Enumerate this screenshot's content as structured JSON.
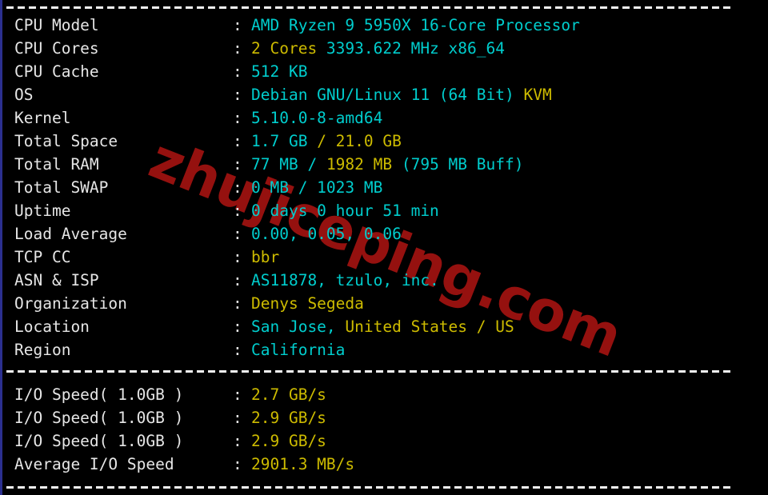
{
  "terminal": {
    "watermark": "zhujiceping.com",
    "colon": ":",
    "colors": {
      "background": "#000000",
      "label": "#e6e6e6",
      "cyan": "#00cdcd",
      "yellow": "#cdbb00",
      "watermark": "#9c1210",
      "gutter": "#2b2f8f",
      "rule": "#f2f2f2"
    }
  },
  "system_info": [
    {
      "label": "CPU Model",
      "segments": [
        {
          "text": "AMD Ryzen 9 5950X 16-Core Processor",
          "color": "cyan"
        }
      ]
    },
    {
      "label": "CPU Cores",
      "segments": [
        {
          "text": "2 Cores ",
          "color": "yellow"
        },
        {
          "text": "3393.622 MHz x86_64",
          "color": "cyan"
        }
      ]
    },
    {
      "label": "CPU Cache",
      "segments": [
        {
          "text": "512 KB",
          "color": "cyan"
        }
      ]
    },
    {
      "label": "OS",
      "segments": [
        {
          "text": "Debian GNU/Linux 11 (64 Bit) ",
          "color": "cyan"
        },
        {
          "text": "KVM",
          "color": "yellow"
        }
      ]
    },
    {
      "label": "Kernel",
      "segments": [
        {
          "text": "5.10.0-8-amd64",
          "color": "cyan"
        }
      ]
    },
    {
      "label": "Total Space",
      "segments": [
        {
          "text": "1.7 GB ",
          "color": "cyan"
        },
        {
          "text": "/ ",
          "color": "yellow"
        },
        {
          "text": "21.0 GB",
          "color": "yellow"
        }
      ]
    },
    {
      "label": "Total RAM",
      "segments": [
        {
          "text": "77 MB ",
          "color": "cyan"
        },
        {
          "text": "/ ",
          "color": "cyan"
        },
        {
          "text": "1982 MB ",
          "color": "yellow"
        },
        {
          "text": "(795 MB Buff)",
          "color": "cyan"
        }
      ]
    },
    {
      "label": "Total SWAP",
      "segments": [
        {
          "text": "0 MB / 1023 MB",
          "color": "cyan"
        }
      ]
    },
    {
      "label": "Uptime",
      "segments": [
        {
          "text": "0 days 0 hour 51 min",
          "color": "cyan"
        }
      ]
    },
    {
      "label": "Load Average",
      "segments": [
        {
          "text": "0.00, 0.05, 0.06",
          "color": "cyan"
        }
      ]
    },
    {
      "label": "TCP CC",
      "segments": [
        {
          "text": "bbr",
          "color": "yellow"
        }
      ]
    },
    {
      "label": "ASN & ISP",
      "segments": [
        {
          "text": "AS11878, tzulo, inc.",
          "color": "cyan"
        }
      ]
    },
    {
      "label": "Organization",
      "segments": [
        {
          "text": "Denys Segeda",
          "color": "yellow"
        }
      ]
    },
    {
      "label": "Location",
      "segments": [
        {
          "text": "San Jose, ",
          "color": "cyan"
        },
        {
          "text": "United States / US",
          "color": "yellow"
        }
      ]
    },
    {
      "label": "Region",
      "segments": [
        {
          "text": "California",
          "color": "cyan"
        }
      ]
    }
  ],
  "io_tests": [
    {
      "label": "I/O Speed( 1.0GB )",
      "segments": [
        {
          "text": "2.7 GB/s",
          "color": "yellow"
        }
      ]
    },
    {
      "label": "I/O Speed( 1.0GB )",
      "segments": [
        {
          "text": "2.9 GB/s",
          "color": "yellow"
        }
      ]
    },
    {
      "label": "I/O Speed( 1.0GB )",
      "segments": [
        {
          "text": "2.9 GB/s",
          "color": "yellow"
        }
      ]
    },
    {
      "label": "Average I/O Speed",
      "segments": [
        {
          "text": "2901.3 MB/s",
          "color": "yellow"
        }
      ]
    }
  ]
}
